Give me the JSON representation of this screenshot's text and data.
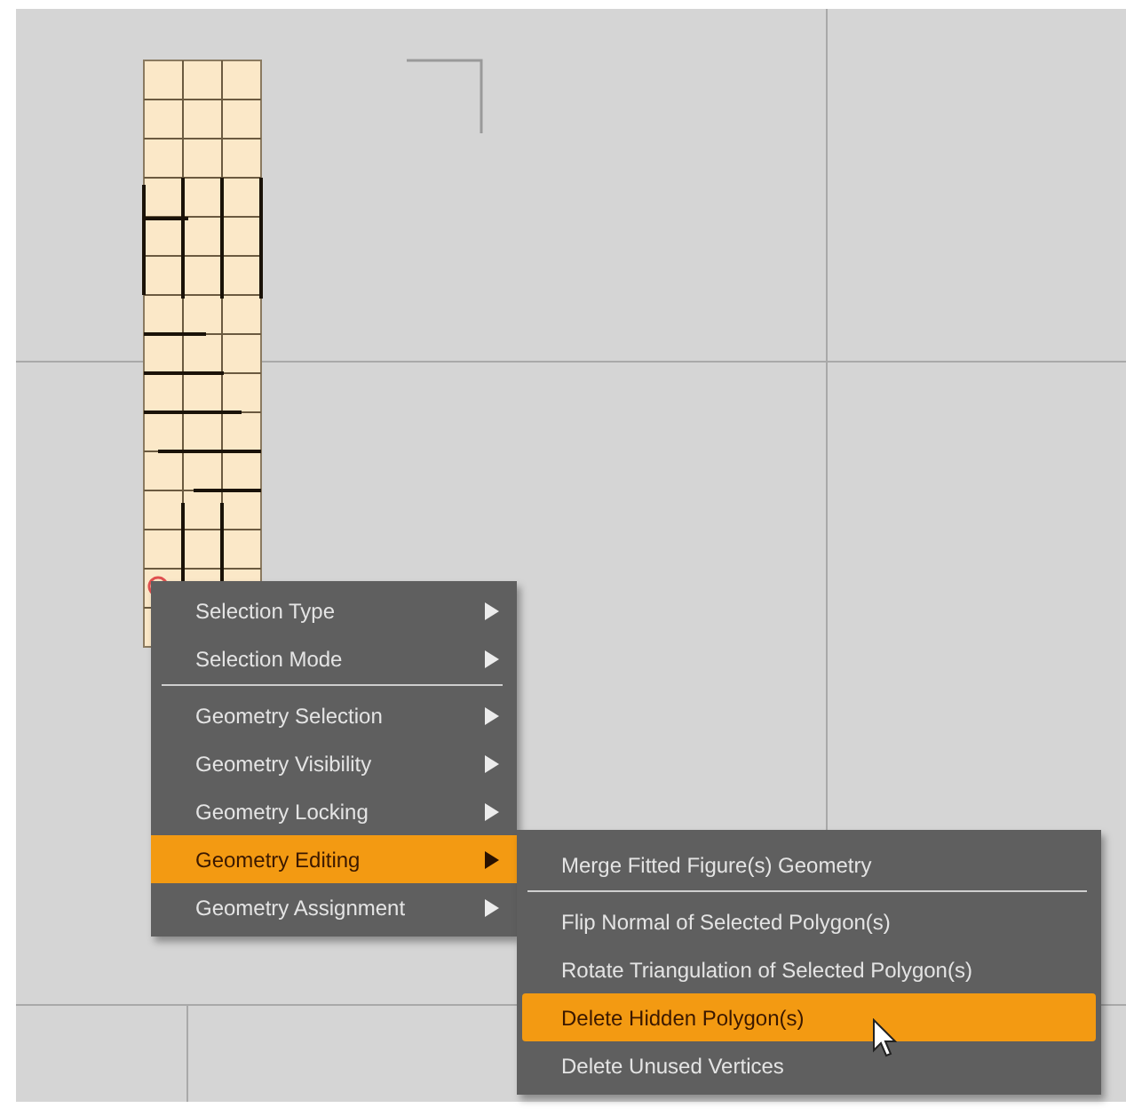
{
  "context_menu": {
    "groups": [
      [
        {
          "label": "Selection Type",
          "has_submenu": true,
          "selected": false
        },
        {
          "label": "Selection Mode",
          "has_submenu": true,
          "selected": false
        }
      ],
      [
        {
          "label": "Geometry Selection",
          "has_submenu": true,
          "selected": false
        },
        {
          "label": "Geometry Visibility",
          "has_submenu": true,
          "selected": false
        },
        {
          "label": "Geometry Locking",
          "has_submenu": true,
          "selected": false
        },
        {
          "label": "Geometry Editing",
          "has_submenu": true,
          "selected": true
        },
        {
          "label": "Geometry Assignment",
          "has_submenu": true,
          "selected": false
        }
      ]
    ]
  },
  "submenu": {
    "groups": [
      [
        {
          "label": "Merge Fitted Figure(s) Geometry",
          "has_submenu": false,
          "selected": false
        }
      ],
      [
        {
          "label": "Flip Normal of Selected Polygon(s)",
          "has_submenu": false,
          "selected": false
        },
        {
          "label": "Rotate Triangulation of Selected Polygon(s)",
          "has_submenu": false,
          "selected": false
        },
        {
          "label": "Delete Hidden Polygon(s)",
          "has_submenu": false,
          "selected": true
        },
        {
          "label": "Delete Unused Vertices",
          "has_submenu": false,
          "selected": false
        }
      ]
    ]
  }
}
